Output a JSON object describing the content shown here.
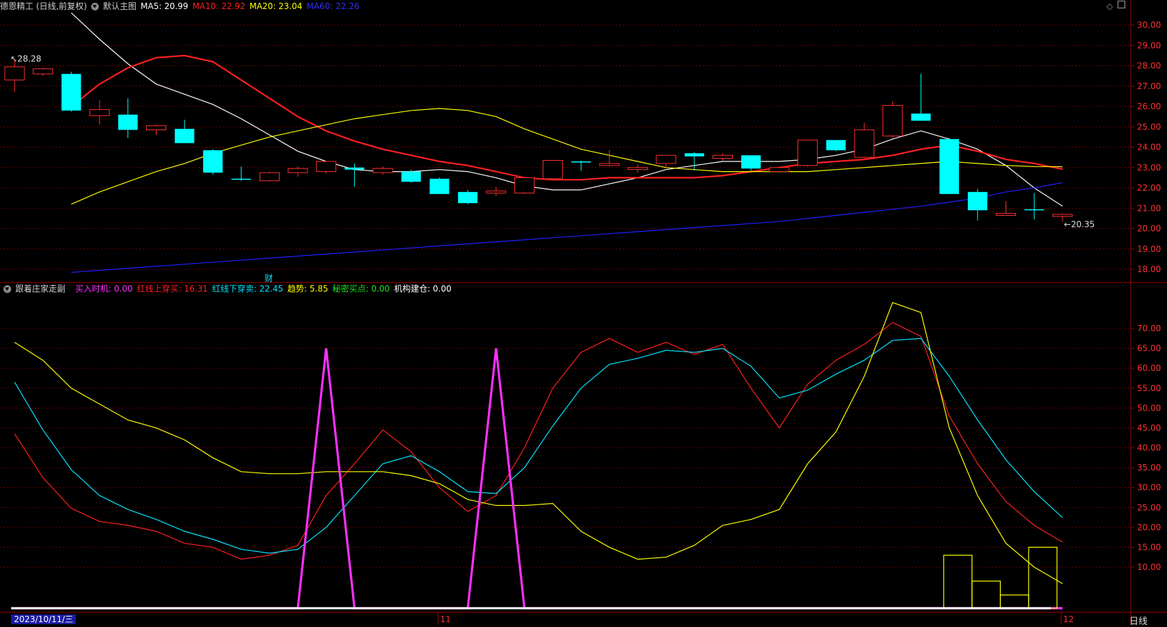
{
  "header": {
    "title": "德恩精工 (日线,前复权)",
    "main_name": "默认主图",
    "ma5": {
      "label": "MA5: 20.99",
      "color": "#ffffff"
    },
    "ma10": {
      "label": "MA10: 22.92",
      "color": "#ff2020"
    },
    "ma20": {
      "label": "MA20: 23.04",
      "color": "#ffff00"
    },
    "ma60": {
      "label": "MA60: 22.26",
      "color": "#3030ff"
    }
  },
  "sub_header": {
    "name": "跟着庄家走副",
    "items": [
      {
        "label": "买入时机: 0.00",
        "color": "#ff30ff"
      },
      {
        "label": "红线上穿买: 16.31",
        "color": "#ff2020"
      },
      {
        "label": "红线下穿卖: 22.45",
        "color": "#00e5ff"
      },
      {
        "label": "趋势: 5.85",
        "color": "#ffff00"
      },
      {
        "label": "秘密买点: 0.00",
        "color": "#20e020"
      },
      {
        "label": "机构建仓: 0.00",
        "color": "#ffffff"
      }
    ]
  },
  "x_axis": {
    "date_label": "2023/10/11/三",
    "month_ticks": [
      "11",
      "12"
    ],
    "period_label": "日线"
  },
  "icons": [
    "dropdown-icon",
    "diamond-icon",
    "window-icon"
  ],
  "chart_data": [
    {
      "type": "candlestick",
      "title": "默认主图",
      "ylim": [
        17.5,
        30.5
      ],
      "yticks": [
        "18.00",
        "19.00",
        "20.00",
        "21.00",
        "22.00",
        "23.00",
        "24.00",
        "25.00",
        "26.00",
        "27.00",
        "28.00",
        "29.00",
        "30.00"
      ],
      "annotations": [
        {
          "text": "28.28",
          "index": 0
        },
        {
          "text": "←20.35",
          "index": 37
        },
        {
          "text": "财",
          "index": 9
        }
      ],
      "candles": [
        {
          "o": 27.3,
          "h": 28.28,
          "l": 26.7,
          "c": 27.95
        },
        {
          "o": 27.6,
          "h": 27.9,
          "l": 27.5,
          "c": 27.85
        },
        {
          "o": 27.6,
          "h": 27.7,
          "l": 25.75,
          "c": 25.8
        },
        {
          "o": 25.55,
          "h": 26.3,
          "l": 25.1,
          "c": 25.85
        },
        {
          "o": 25.6,
          "h": 26.4,
          "l": 24.45,
          "c": 24.85
        },
        {
          "o": 24.85,
          "h": 25.1,
          "l": 24.6,
          "c": 25.05
        },
        {
          "o": 24.9,
          "h": 25.35,
          "l": 24.2,
          "c": 24.2
        },
        {
          "o": 23.85,
          "h": 23.9,
          "l": 22.65,
          "c": 22.75
        },
        {
          "o": 22.45,
          "h": 23.05,
          "l": 22.35,
          "c": 22.4
        },
        {
          "o": 22.35,
          "h": 22.8,
          "l": 22.3,
          "c": 22.75
        },
        {
          "o": 22.75,
          "h": 23.05,
          "l": 22.55,
          "c": 22.95
        },
        {
          "o": 22.8,
          "h": 23.3,
          "l": 22.7,
          "c": 23.3
        },
        {
          "o": 23.0,
          "h": 23.2,
          "l": 22.05,
          "c": 22.9
        },
        {
          "o": 22.75,
          "h": 23.05,
          "l": 22.65,
          "c": 22.95
        },
        {
          "o": 22.8,
          "h": 22.9,
          "l": 22.25,
          "c": 22.3
        },
        {
          "o": 22.45,
          "h": 22.5,
          "l": 21.7,
          "c": 21.7
        },
        {
          "o": 21.8,
          "h": 21.9,
          "l": 21.2,
          "c": 21.25
        },
        {
          "o": 21.75,
          "h": 22.05,
          "l": 21.6,
          "c": 21.85
        },
        {
          "o": 21.75,
          "h": 22.5,
          "l": 21.7,
          "c": 22.5
        },
        {
          "o": 22.45,
          "h": 23.35,
          "l": 22.4,
          "c": 23.35
        },
        {
          "o": 23.3,
          "h": 23.35,
          "l": 22.85,
          "c": 23.25
        },
        {
          "o": 23.1,
          "h": 23.85,
          "l": 23.05,
          "c": 23.2
        },
        {
          "o": 22.9,
          "h": 23.15,
          "l": 22.75,
          "c": 23.0
        },
        {
          "o": 23.2,
          "h": 23.6,
          "l": 23.0,
          "c": 23.6
        },
        {
          "o": 23.7,
          "h": 23.75,
          "l": 22.85,
          "c": 23.55
        },
        {
          "o": 23.45,
          "h": 23.7,
          "l": 23.35,
          "c": 23.6
        },
        {
          "o": 23.6,
          "h": 23.6,
          "l": 22.85,
          "c": 22.95
        },
        {
          "o": 22.8,
          "h": 23.05,
          "l": 22.75,
          "c": 23.0
        },
        {
          "o": 23.1,
          "h": 24.35,
          "l": 23.05,
          "c": 24.35
        },
        {
          "o": 24.35,
          "h": 24.35,
          "l": 23.8,
          "c": 23.85
        },
        {
          "o": 23.5,
          "h": 25.2,
          "l": 23.45,
          "c": 24.85
        },
        {
          "o": 24.55,
          "h": 26.25,
          "l": 24.5,
          "c": 26.05
        },
        {
          "o": 25.65,
          "h": 27.6,
          "l": 25.3,
          "c": 25.3
        },
        {
          "o": 24.4,
          "h": 24.45,
          "l": 21.7,
          "c": 21.7
        },
        {
          "o": 21.8,
          "h": 21.95,
          "l": 20.4,
          "c": 20.9
        },
        {
          "o": 20.65,
          "h": 21.35,
          "l": 20.65,
          "c": 20.75
        },
        {
          "o": 20.95,
          "h": 21.75,
          "l": 20.45,
          "c": 20.9
        },
        {
          "o": 20.6,
          "h": 20.75,
          "l": 20.35,
          "c": 20.7
        }
      ],
      "series": [
        {
          "name": "MA5",
          "color": "#ffffff",
          "values": [
            30.6,
            29.3,
            28.1,
            27.1,
            26.6,
            26.1,
            25.4,
            24.6,
            23.8,
            23.3,
            22.9,
            22.8,
            22.8,
            22.9,
            22.8,
            22.5,
            22.1,
            21.9,
            21.9,
            22.2,
            22.5,
            22.9,
            23.1,
            23.3,
            23.3,
            23.3,
            23.4,
            23.6,
            23.9,
            24.4,
            24.8,
            24.4,
            23.9,
            23.1,
            22.0,
            21.1
          ]
        },
        {
          "name": "MA10",
          "color": "#ff2020",
          "values": [
            26.0,
            27.1,
            27.9,
            28.4,
            28.5,
            28.2,
            27.3,
            26.4,
            25.5,
            24.8,
            24.3,
            23.9,
            23.6,
            23.3,
            23.1,
            22.8,
            22.5,
            22.4,
            22.4,
            22.5,
            22.5,
            22.5,
            22.5,
            22.6,
            22.8,
            23.0,
            23.2,
            23.3,
            23.4,
            23.6,
            23.9,
            24.1,
            23.8,
            23.4,
            23.2,
            22.92
          ]
        },
        {
          "name": "MA20",
          "color": "#ffff00",
          "values": [
            21.2,
            21.8,
            22.3,
            22.8,
            23.2,
            23.7,
            24.1,
            24.5,
            24.8,
            25.1,
            25.4,
            25.6,
            25.8,
            25.9,
            25.8,
            25.5,
            24.9,
            24.4,
            23.9,
            23.6,
            23.3,
            23.0,
            22.9,
            22.8,
            22.8,
            22.8,
            22.8,
            22.9,
            23.0,
            23.1,
            23.2,
            23.3,
            23.2,
            23.1,
            23.05,
            23.04
          ]
        },
        {
          "name": "MA60",
          "color": "#2020ff",
          "values": [
            17.85,
            17.95,
            18.05,
            18.15,
            18.25,
            18.35,
            18.45,
            18.55,
            18.65,
            18.75,
            18.85,
            18.95,
            19.05,
            19.15,
            19.25,
            19.35,
            19.45,
            19.55,
            19.65,
            19.75,
            19.85,
            19.95,
            20.05,
            20.15,
            20.25,
            20.35,
            20.5,
            20.65,
            20.8,
            20.95,
            21.1,
            21.3,
            21.5,
            21.8,
            22.0,
            22.26
          ]
        }
      ]
    },
    {
      "type": "line",
      "title": "跟着庄家走副",
      "ylim": [
        0,
        77
      ],
      "yticks": [
        "10.00",
        "15.00",
        "20.00",
        "25.00",
        "30.00",
        "35.00",
        "40.00",
        "45.00",
        "50.00",
        "55.00",
        "60.00",
        "65.00",
        "70.00"
      ],
      "series": [
        {
          "name": "红线上穿买",
          "color": "#ff2020",
          "values": [
            43.5,
            32.5,
            24.8,
            21.5,
            20.5,
            19.0,
            16.0,
            15.0,
            12.0,
            13.0,
            15.5,
            28.0,
            36.0,
            44.5,
            39.0,
            30.0,
            24.0,
            28.0,
            40.0,
            55.0,
            64.0,
            67.5,
            64.0,
            66.5,
            63.5,
            66.0,
            55.0,
            45.0,
            56.0,
            62.0,
            66.0,
            71.5,
            68.0,
            48.0,
            36.0,
            26.5,
            20.5,
            16.31
          ]
        },
        {
          "name": "红线下穿卖",
          "color": "#00e5ff",
          "values": [
            56.5,
            44.5,
            34.5,
            28.0,
            24.5,
            22.0,
            19.0,
            17.0,
            14.5,
            13.5,
            14.5,
            20.0,
            28.0,
            36.0,
            38.0,
            34.0,
            29.0,
            28.5,
            35.0,
            45.5,
            55.0,
            61.0,
            62.5,
            64.5,
            64.0,
            65.0,
            60.5,
            52.5,
            54.5,
            58.5,
            62.0,
            67.0,
            67.5,
            58.0,
            47.0,
            37.0,
            29.0,
            22.45
          ]
        },
        {
          "name": "趋势",
          "color": "#ffff00",
          "values": [
            66.5,
            62.0,
            55.0,
            51.0,
            47.0,
            45.0,
            42.0,
            37.5,
            34.0,
            33.5,
            33.5,
            34.0,
            34.0,
            34.0,
            33.0,
            31.0,
            27.0,
            25.5,
            25.5,
            26.0,
            19.0,
            15.0,
            12.0,
            12.5,
            15.5,
            20.5,
            22.0,
            24.5,
            36.0,
            44.0,
            58.0,
            76.5,
            74.0,
            45.0,
            28.0,
            16.0,
            10.0,
            5.85
          ]
        },
        {
          "name": "买入时机",
          "color": "#ff30ff",
          "values": [
            0,
            0,
            0,
            0,
            0,
            0,
            0,
            0,
            0,
            0,
            0,
            65.0,
            0,
            0,
            0,
            0,
            0,
            65.0,
            0,
            0,
            0,
            0,
            0,
            0,
            0,
            0,
            0,
            0,
            0,
            0,
            0,
            0,
            0,
            0,
            0,
            0,
            0,
            0
          ]
        }
      ],
      "boxes": [
        {
          "from": 33,
          "to": 34,
          "value": 13.0
        },
        {
          "from": 34,
          "to": 35,
          "value": 6.5
        },
        {
          "from": 35,
          "to": 36,
          "value": 3.0
        },
        {
          "from": 36,
          "to": 37,
          "value": 15.0
        }
      ]
    }
  ]
}
